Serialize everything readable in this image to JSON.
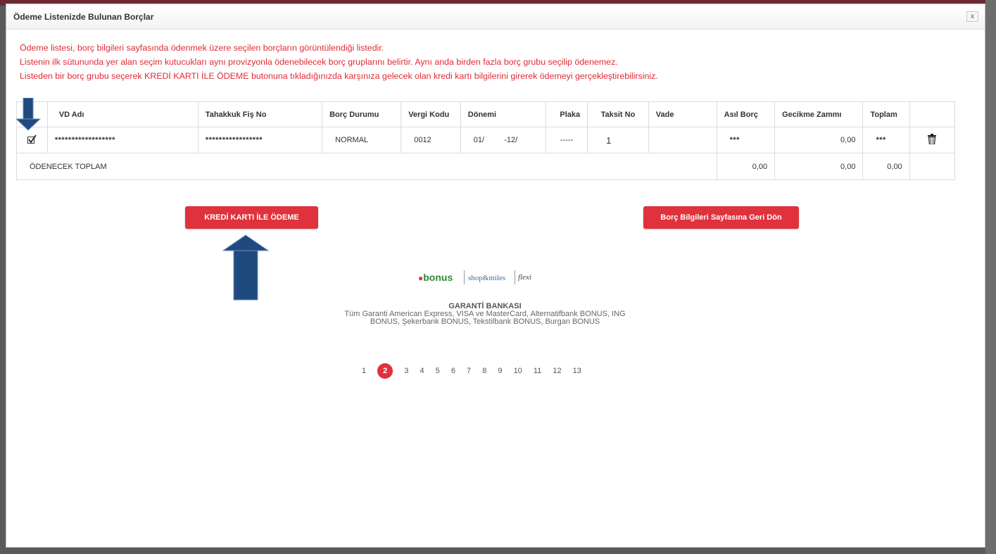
{
  "dialog": {
    "title": "Ödeme Listenizde Bulunan Borçlar",
    "close_label": "x"
  },
  "info_lines": [
    "Ödeme listesi, borç bilgileri sayfasında ödenmek üzere seçilen borçların görüntülendiği listedir.",
    "Listenin ilk sütununda yer alan seçim kutucukları aynı provizyonla ödenebilecek borç gruplarını belirtir. Aynı anda birden fazla borç grubu seçilip ödenemez.",
    "Listeden bir borç grubu seçerek KREDİ KARTI İLE ÖDEME butonuna tıkladığınızda karşınıza gelecek olan kredi kartı bilgilerini girerek ödemeyi gerçekleştirebilirsiniz."
  ],
  "table": {
    "headers": [
      "",
      "VD Adı",
      "Tahakkuk Fiş No",
      "Borç Durumu",
      "Vergi Kodu",
      "Dönemi",
      "Plaka",
      "Taksit No",
      "Vade",
      "Asıl Borç",
      "Gecikme Zammı",
      "Toplam",
      ""
    ],
    "row": {
      "checked": true,
      "vd_adi": "******************",
      "fis_no": "*****************",
      "durum": "NORMAL",
      "vergi_kodu": "0012",
      "donem_start": "01/",
      "donem_end": "-12/",
      "plaka": "-----",
      "taksit": "1",
      "vade": "",
      "asil_borc": "***",
      "gecikme": "0,00",
      "toplam": "***"
    },
    "total": {
      "label": "ÖDENECEK TOPLAM",
      "asil_borc": "0,00",
      "gecikme": "0,00",
      "toplam": "0,00"
    }
  },
  "buttons": {
    "pay": "KREDİ KARTI İLE ÖDEME",
    "back": "Borç Bilgileri Sayfasına Geri Dön"
  },
  "logos": {
    "bonus": "bonus",
    "shop": "shop&miles",
    "flexi": "flexi"
  },
  "bank": {
    "name": "GARANTİ BANKASI",
    "line1": "Tüm Garanti American Express, VISA ve MasterCard, Alternatifbank BONUS, ING",
    "line2": "BONUS, Şekerbank BONUS, Tekstilbank BONUS, Burgan BONUS"
  },
  "pagination": {
    "pages": [
      "1",
      "2",
      "3",
      "4",
      "5",
      "6",
      "7",
      "8",
      "9",
      "10",
      "11",
      "12",
      "13"
    ],
    "active": "2"
  },
  "colors": {
    "accent_red": "#e0323c",
    "arrow_blue": "#1f4a7f"
  },
  "icons": [
    "checkbox-checked-icon",
    "trash-icon",
    "close-icon"
  ]
}
